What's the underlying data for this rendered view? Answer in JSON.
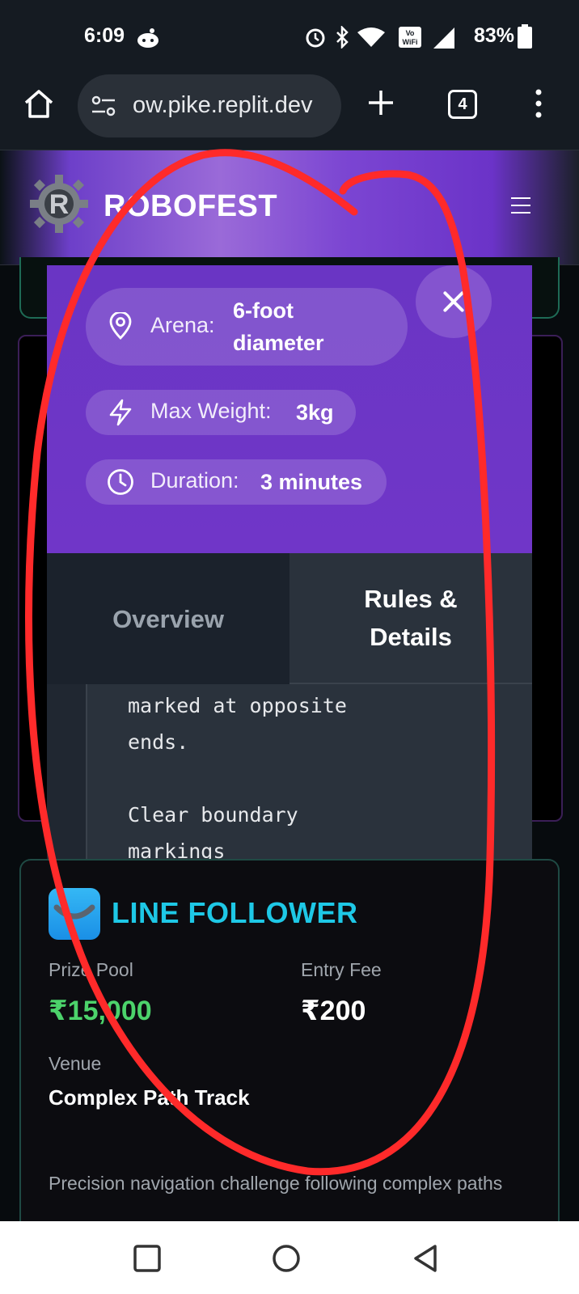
{
  "status_bar": {
    "time": "6:09",
    "battery": "83%",
    "wifi_badge": "VoWiFi"
  },
  "browser": {
    "url": "ow.pike.replit.dev",
    "tab_count": "4"
  },
  "header": {
    "brand": "ROBOFEST",
    "logo_letter": "R"
  },
  "modal": {
    "specs": [
      {
        "icon": "location-pin-icon",
        "label": "Arena:",
        "value_line1": "6-foot",
        "value_line2": "diameter"
      },
      {
        "icon": "lightning-icon",
        "label": "Max Weight:",
        "value": "3kg"
      },
      {
        "icon": "clock-icon",
        "label": "Duration:",
        "value": "3 minutes"
      }
    ],
    "tabs": {
      "overview": "Overview",
      "rules_line1": "Rules &",
      "rules_line2": "Details"
    },
    "rules_text": "marked at opposite\nends.\n\nClear boundary\nmarkings"
  },
  "line_follower": {
    "title": "LINE FOLLOWER",
    "prize_label": "Prize Pool",
    "prize_value": "₹15,000",
    "fee_label": "Entry Fee",
    "fee_value": "₹200",
    "venue_label": "Venue",
    "venue_value": "Complex Path Track",
    "description": "Precision navigation challenge following complex paths"
  },
  "colors": {
    "accent_purple": "#6a35c4",
    "prize_green": "#4cd36b",
    "title_cyan": "#1ec8e6",
    "annotation_red": "#ff2a2a"
  }
}
